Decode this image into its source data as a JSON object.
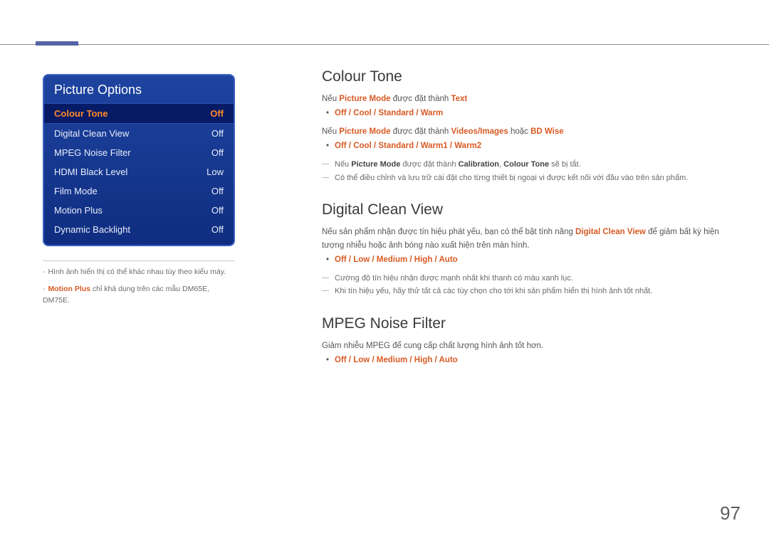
{
  "page_number": "97",
  "menu": {
    "title": "Picture Options",
    "rows": [
      {
        "label": "Colour Tone",
        "value": "Off",
        "selected": true
      },
      {
        "label": "Digital Clean View",
        "value": "Off",
        "selected": false
      },
      {
        "label": "MPEG Noise Filter",
        "value": "Off",
        "selected": false
      },
      {
        "label": "HDMI Black Level",
        "value": "Low",
        "selected": false
      },
      {
        "label": "Film Mode",
        "value": "Off",
        "selected": false
      },
      {
        "label": "Motion Plus",
        "value": "Off",
        "selected": false
      },
      {
        "label": "Dynamic Backlight",
        "value": "Off",
        "selected": false
      }
    ]
  },
  "captions": {
    "c1_prefix": "Hình ảnh hiển thị có thể khác nhau tùy theo kiểu máy.",
    "c2_hl": "Motion Plus",
    "c2_rest": " chỉ khả dụng trên các mẫu DM65E, DM75E."
  },
  "sections": {
    "colour_tone": {
      "title": "Colour Tone",
      "line1_pre": "Nếu ",
      "line1_b1": "Picture Mode",
      "line1_mid": " được đặt thành ",
      "line1_b2": "Text",
      "opts1": "Off / Cool / Standard / Warm",
      "line2_pre": "Nếu ",
      "line2_b1": "Picture Mode",
      "line2_mid": " được đặt thành ",
      "line2_b2": "Videos/Images",
      "line2_or": " hoặc ",
      "line2_b3": "BD Wise",
      "opts2": "Off / Cool / Standard / Warm1 / Warm2",
      "note1_pre": "Nếu ",
      "note1_b1": "Picture Mode",
      "note1_mid": " được đặt thành ",
      "note1_b2": "Calibration",
      "note1_comma": ", ",
      "note1_b3": "Colour Tone",
      "note1_end": " sẽ bị tắt.",
      "note2": "Có thể điều chỉnh và lưu trữ cài đặt cho từng thiết bị ngoại vi được kết nối với đầu vào trên sản phẩm."
    },
    "dcv": {
      "title": "Digital Clean View",
      "p1_pre": "Nếu sản phẩm nhận được tín hiệu phát yếu, bạn có thể bật tính năng ",
      "p1_hl": "Digital Clean View",
      "p1_post": " để giảm bất kỳ hiện tượng nhiễu hoặc ảnh bóng nào xuất hiện trên màn hình.",
      "opts": "Off / Low / Medium / High / Auto",
      "note1": "Cường độ tín hiệu nhận được mạnh nhất khi thanh có màu xanh lục.",
      "note2": "Khi tín hiệu yếu, hãy thử tất cả các tùy chọn cho tới khi sản phẩm hiển thị hình ảnh tốt nhất."
    },
    "mpeg": {
      "title": "MPEG Noise Filter",
      "p1": "Giảm nhiễu MPEG để cung cấp chất lượng hình ảnh tốt hơn.",
      "opts": "Off / Low / Medium / High / Auto"
    }
  }
}
